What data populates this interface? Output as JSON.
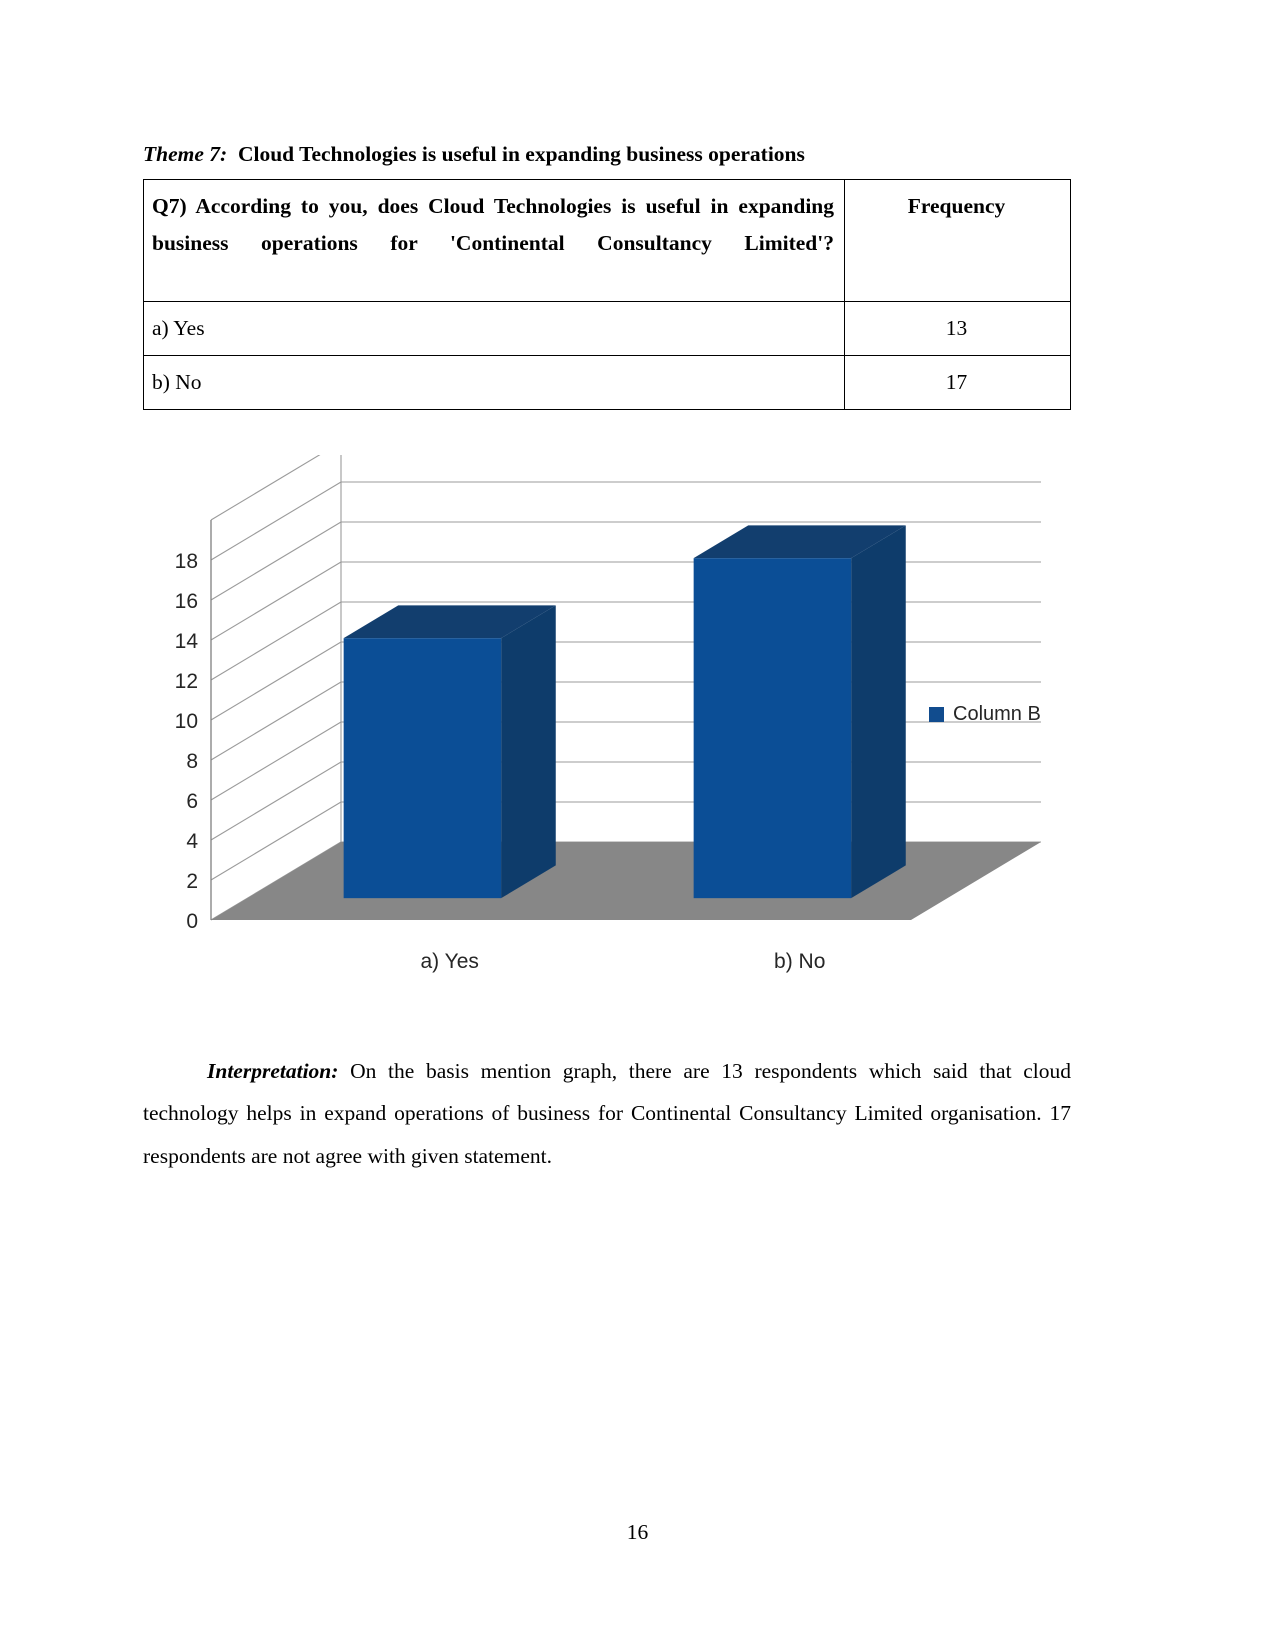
{
  "document": {
    "theme_label": "Theme 7:",
    "theme_text": "Cloud Technologies is useful in expanding business operations",
    "page_number": "16"
  },
  "table": {
    "question": "Q7) According to you, does Cloud Technologies is useful in expanding business operations for 'Continental Consultancy Limited'?",
    "frequency_header": "Frequency",
    "rows": [
      {
        "option": "a) Yes",
        "frequency": "13"
      },
      {
        "option": "b) No",
        "frequency": "17"
      }
    ]
  },
  "interpretation": {
    "label": "Interpretation:",
    "text": " On the basis mention graph, there are 13 respondents which said that cloud technology helps in expand operations of business for Continental Consultancy Limited organisation. 17 respondents are not agree with given statement."
  },
  "chart_data": {
    "type": "bar",
    "title": "",
    "xlabel": "",
    "ylabel": "",
    "categories": [
      "a) Yes",
      "b) No"
    ],
    "values": [
      13,
      17
    ],
    "series": [
      {
        "name": "Column B",
        "values": [
          13,
          17
        ]
      }
    ],
    "legend": [
      "Column B"
    ],
    "legend_position": "right",
    "ylim": [
      0,
      20
    ],
    "yticks": [
      "0",
      "2",
      "4",
      "6",
      "8",
      "10",
      "12",
      "14",
      "16",
      "18"
    ],
    "ytick_values": [
      0,
      2,
      4,
      6,
      8,
      10,
      12,
      14,
      16,
      18
    ],
    "grid": true,
    "three_d": true,
    "colors": {
      "bar_front": "#0B4E96",
      "bar_top": "#123E6E",
      "bar_side": "#0E3C6B",
      "floor": "#878787",
      "gridline": "#9B9B9B",
      "axis": "#808080",
      "legend_swatch": "#114C8E",
      "tick_text": "#262626"
    }
  }
}
